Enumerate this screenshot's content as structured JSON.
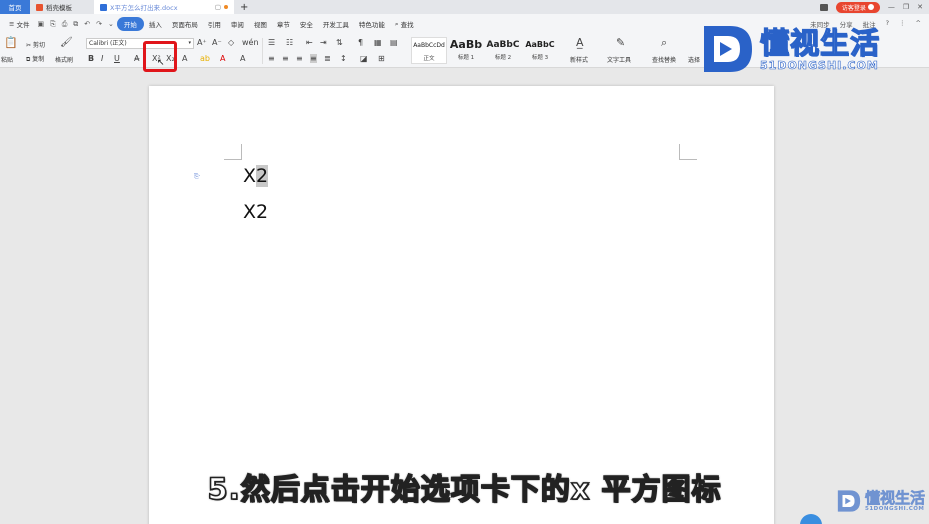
{
  "titlebar": {
    "tabs": [
      {
        "label": "首页"
      },
      {
        "label": "稻壳模板"
      },
      {
        "label": "X平方怎么打出来.docx"
      }
    ],
    "new_tab": "+",
    "login_label": "访客登录"
  },
  "menubar": {
    "file_label": "文件",
    "items": [
      "开始",
      "插入",
      "页面布局",
      "引用",
      "审阅",
      "视图",
      "章节",
      "安全",
      "开发工具",
      "特色功能"
    ],
    "search_label": "查找",
    "right_items": [
      "未同步",
      "分享",
      "批注"
    ]
  },
  "ribbon": {
    "paste_label": "粘贴",
    "cut_label": "剪切",
    "copy_label": "复制",
    "format_painter_label": "格式刷",
    "font_name": "Calibri (正文)",
    "styles": [
      {
        "sample": "AaBbCcDd",
        "name": "正文"
      },
      {
        "sample": "AaBb",
        "name": "标题 1"
      },
      {
        "sample": "AaBbC",
        "name": "标题 2"
      },
      {
        "sample": "AaBbC",
        "name": "标题 3"
      }
    ],
    "new_style_label": "新样式",
    "text_tools_label": "文字工具",
    "find_replace_label": "查找替换",
    "select_label": "选择"
  },
  "logo": {
    "name": "懂视生活",
    "domain": "51DONGSHI.COM"
  },
  "document": {
    "line1_prefix": "X",
    "line1_selected": "2",
    "line2": "X2"
  },
  "caption": "5.然后点击开始选项卡下的x 平方图标",
  "colors": {
    "accent": "#3a79d8",
    "highlight": "#e0151a"
  }
}
